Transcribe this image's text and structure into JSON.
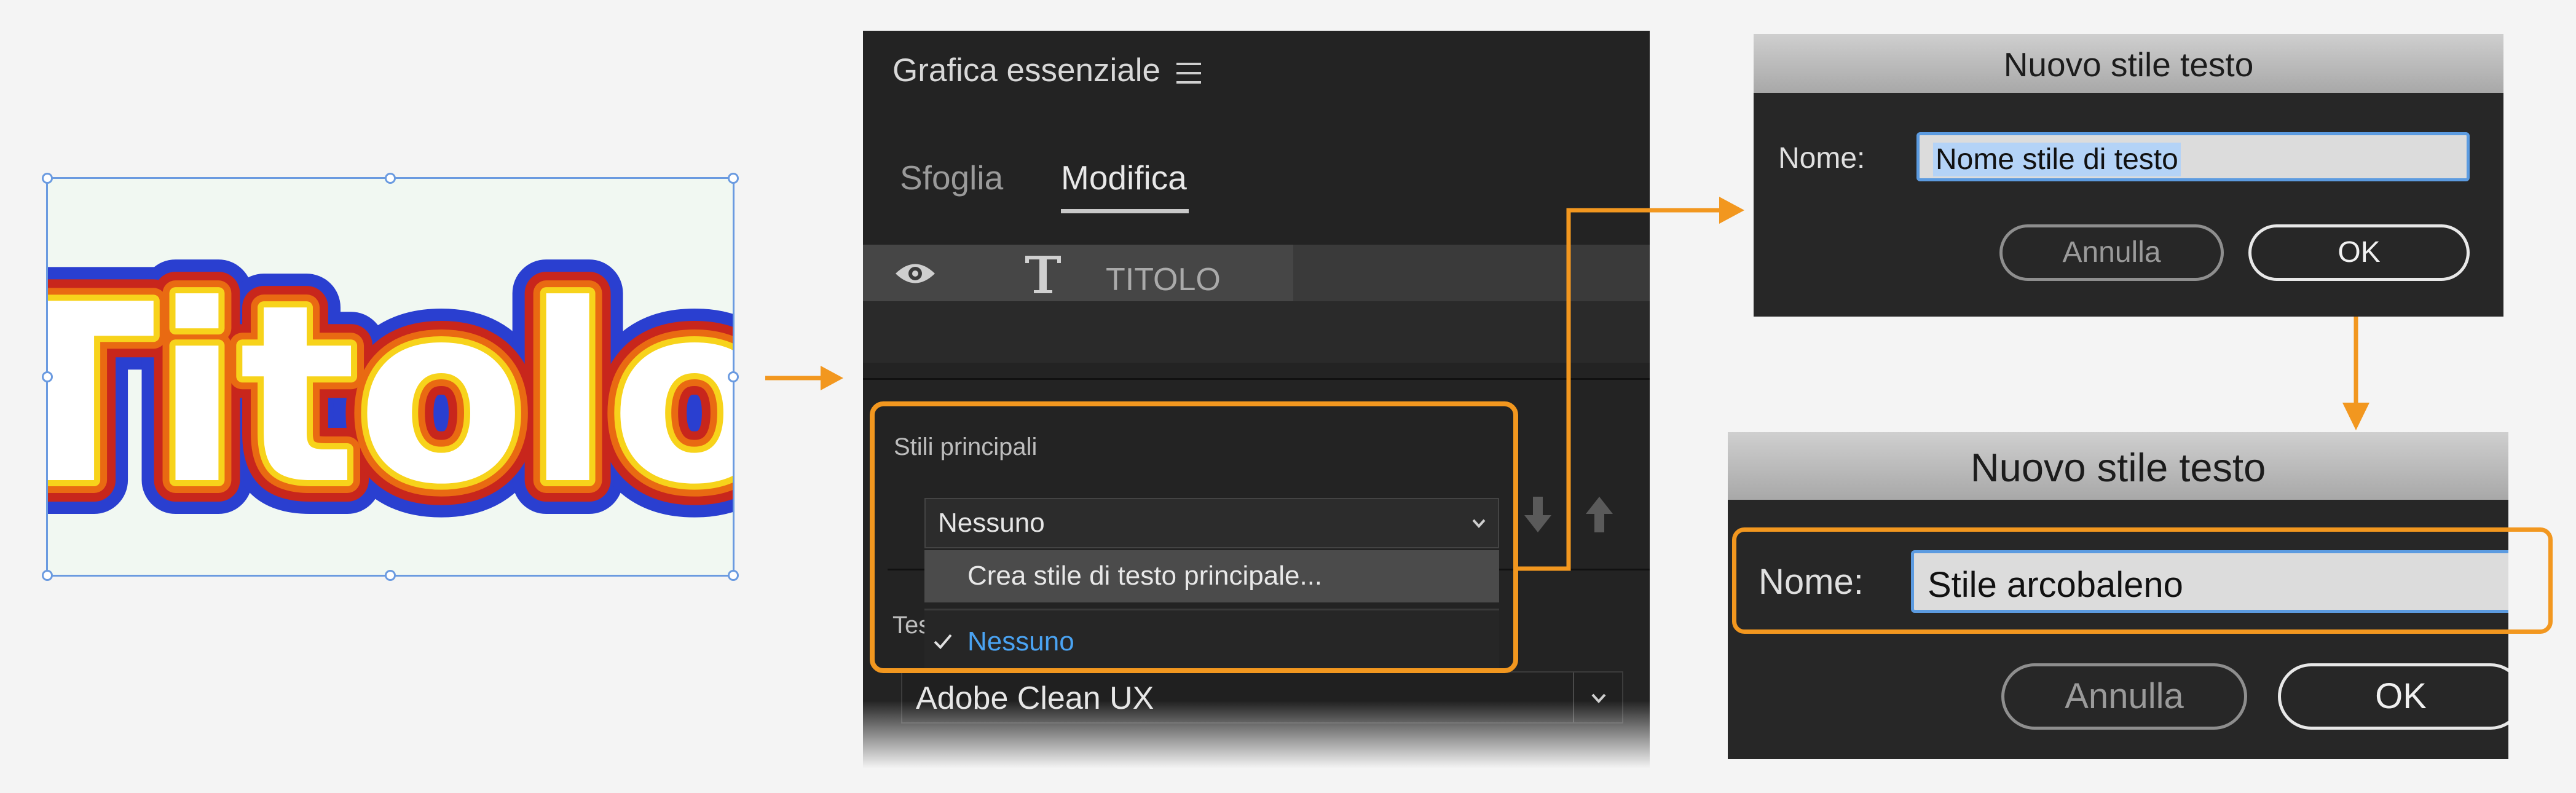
{
  "canvas": {
    "title_text": "Titolo"
  },
  "panel": {
    "title": "Grafica essenziale",
    "tabs": [
      {
        "label": "Sfoglia",
        "active": false
      },
      {
        "label": "Modifica",
        "active": true
      }
    ],
    "layer": {
      "name": "TITOLO",
      "icons": [
        "eye-icon",
        "type-tool-icon"
      ]
    },
    "master_styles": {
      "label": "Stili principali",
      "selected": "Nessuno",
      "menu_items": [
        {
          "label": "Crea stile di testo principale...",
          "highlighted": true
        },
        {
          "label": "Nessuno",
          "checked": true
        }
      ]
    },
    "text_section_label_partial": "Tes",
    "font": "Adobe Clean UX"
  },
  "dialog_1": {
    "title": "Nuovo stile testo",
    "name_label": "Nome:",
    "name_value": "Nome stile di testo",
    "cancel_label": "Annulla",
    "ok_label": "OK"
  },
  "dialog_2": {
    "title": "Nuovo stile testo",
    "name_label": "Nome:",
    "name_value": "Stile arcobaleno",
    "cancel_label": "Annulla",
    "ok_label": "OK"
  },
  "colors": {
    "accent_orange": "#f2971f",
    "selection_blue": "#6a9ae0",
    "link_blue": "#4aa3f2",
    "panel_bg": "#232323"
  }
}
